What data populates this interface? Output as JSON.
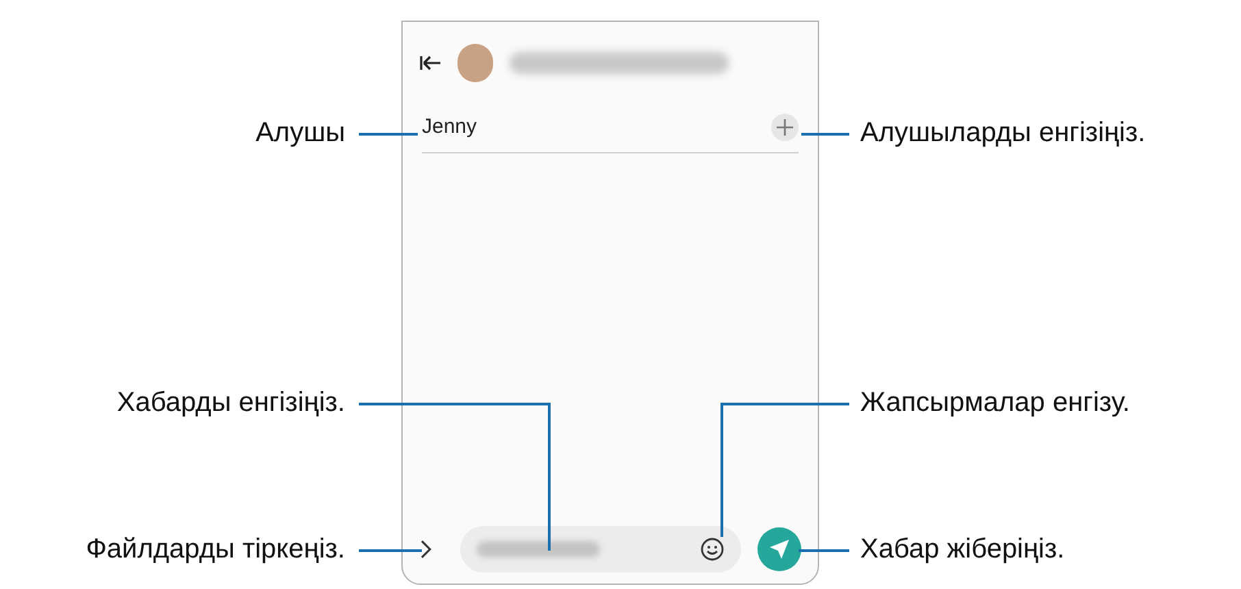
{
  "phone": {
    "recipient": "Jenny"
  },
  "left_callouts": [
    "Алушы",
    "Хабарды енгізіңіз.",
    "Файлдарды тіркеңіз."
  ],
  "right_callouts": [
    "Алушыларды енгізіңіз.",
    "Жапсырмалар енгізу.",
    "Хабар жіберіңіз."
  ]
}
